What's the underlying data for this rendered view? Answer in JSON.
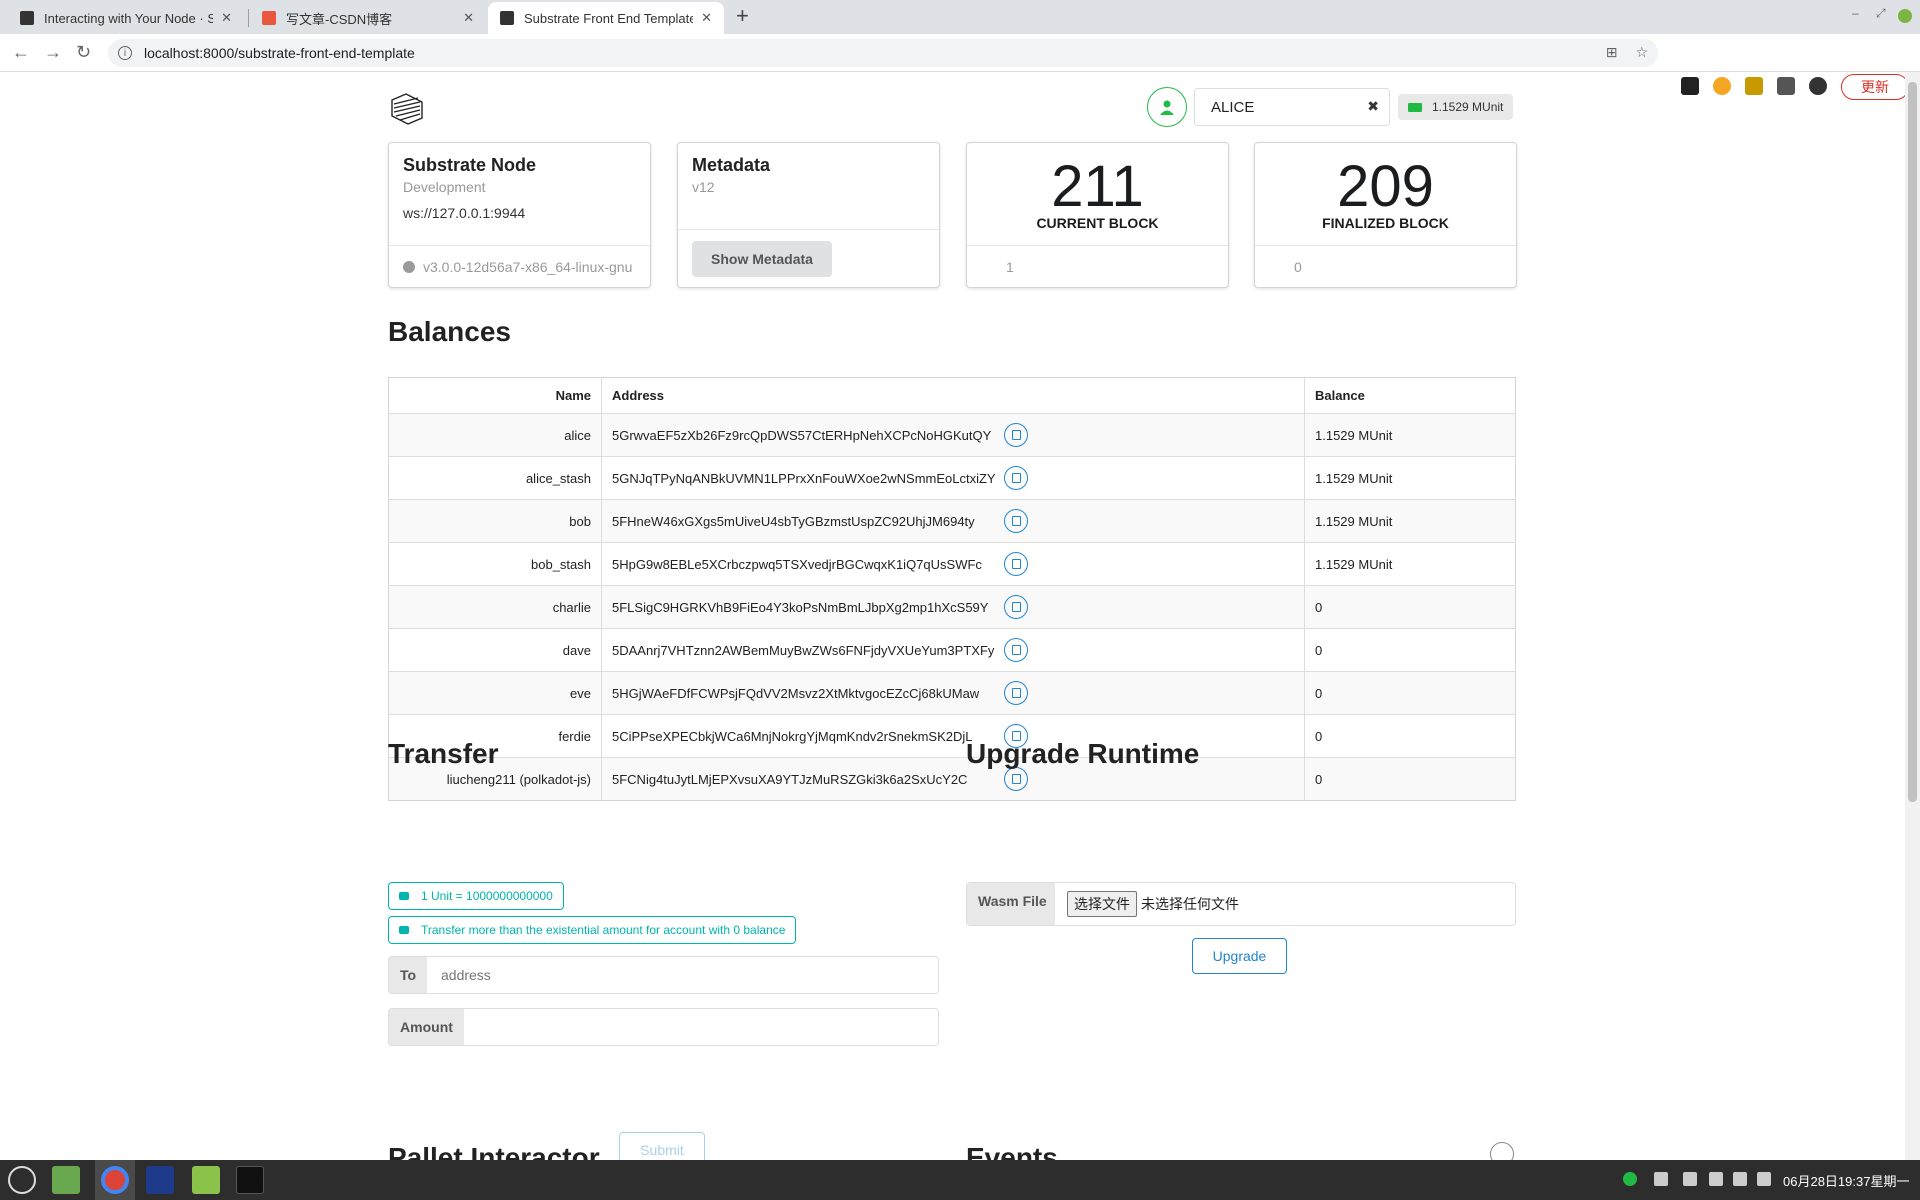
{
  "browser": {
    "tabs": [
      {
        "title": "Interacting with Your Node · S",
        "active": false
      },
      {
        "title": "写文章-CSDN博客",
        "active": false
      },
      {
        "title": "Substrate Front End Template",
        "active": true
      }
    ],
    "url": "localhost:8000/substrate-front-end-template",
    "update_label": "更新"
  },
  "header": {
    "account_name": "ALICE",
    "account_balance": "1.1529 MUnit"
  },
  "cards": {
    "node": {
      "title": "Substrate Node",
      "meta": "Development",
      "endpoint": "ws://127.0.0.1:9944",
      "version": "v3.0.0-12d56a7-x86_64-linux-gnu"
    },
    "metadata": {
      "title": "Metadata",
      "meta": "v12",
      "button": "Show Metadata"
    },
    "current_block": {
      "number": "211",
      "label": "CURRENT BLOCK",
      "timer": "1"
    },
    "finalized_block": {
      "number": "209",
      "label": "FINALIZED BLOCK",
      "timer": "0"
    }
  },
  "balances": {
    "title": "Balances",
    "columns": [
      "Name",
      "Address",
      "Balance"
    ],
    "rows": [
      {
        "name": "alice",
        "address": "5GrwvaEF5zXb26Fz9rcQpDWS57CtERHpNehXCPcNoHGKutQY",
        "balance": "1.1529 MUnit"
      },
      {
        "name": "alice_stash",
        "address": "5GNJqTPyNqANBkUVMN1LPPrxXnFouWXoe2wNSmmEoLctxiZY",
        "balance": "1.1529 MUnit"
      },
      {
        "name": "bob",
        "address": "5FHneW46xGXgs5mUiveU4sbTyGBzmstUspZC92UhjJM694ty",
        "balance": "1.1529 MUnit"
      },
      {
        "name": "bob_stash",
        "address": "5HpG9w8EBLe5XCrbczpwq5TSXvedjrBGCwqxK1iQ7qUsSWFc",
        "balance": "1.1529 MUnit"
      },
      {
        "name": "charlie",
        "address": "5FLSigC9HGRKVhB9FiEo4Y3koPsNmBmLJbpXg2mp1hXcS59Y",
        "balance": "0"
      },
      {
        "name": "dave",
        "address": "5DAAnrj7VHTznn2AWBemMuyBwZWs6FNFjdyVXUeYum3PTXFy",
        "balance": "0"
      },
      {
        "name": "eve",
        "address": "5HGjWAeFDfFCWPsjFQdVV2Msvz2XtMktvgocEZcCj68kUMaw",
        "balance": "0"
      },
      {
        "name": "ferdie",
        "address": "5CiPPseXPECbkjWCa6MnjNokrgYjMqmKndv2rSnekmSK2DjL",
        "balance": "0"
      },
      {
        "name": "liucheng211 (polkadot-js)",
        "address": "5FCNig4tuJytLMjEPXvsuXA9YTJzMuRSZGki3k6a2SxUcY2C",
        "balance": "0"
      }
    ]
  },
  "transfer": {
    "title": "Transfer",
    "info1": "1 Unit = 1000000000000",
    "info2": "Transfer more than the existential amount for account with 0 balance",
    "to_label": "To",
    "to_placeholder": "address",
    "amount_label": "Amount",
    "submit": "Submit"
  },
  "upgrade": {
    "title": "Upgrade Runtime",
    "wasm_label": "Wasm File",
    "choose_label": "选择文件",
    "no_file": "未选择任何文件",
    "button": "Upgrade"
  },
  "sections": {
    "pallet": "Pallet Interactor",
    "events": "Events"
  },
  "taskbar": {
    "clock": "06月28日19:37星期一"
  },
  "colors": {
    "teal": "#00b5ad",
    "blue": "#2185d0",
    "green": "#21ba45"
  }
}
